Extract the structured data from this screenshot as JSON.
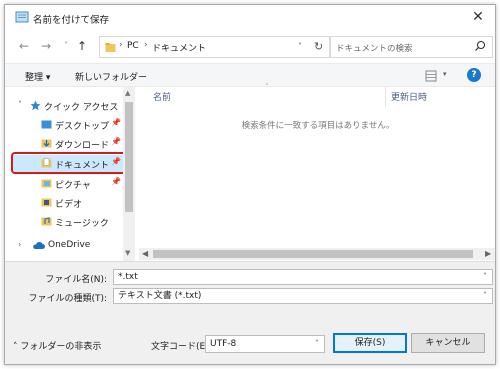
{
  "window": {
    "title": "名前を付けて保存"
  },
  "address_bar": {
    "path": [
      "PC",
      "ドキュメント"
    ],
    "search_placeholder": "ドキュメントの検索"
  },
  "toolbar": {
    "organize": "整理 ▾",
    "new_folder": "新しいフォルダー"
  },
  "nav": {
    "quick_access": "クイック アクセス",
    "items": [
      {
        "label": "デスクトップ"
      },
      {
        "label": "ダウンロード"
      },
      {
        "label": "ドキュメント"
      },
      {
        "label": "ピクチャ"
      },
      {
        "label": "ビデオ"
      },
      {
        "label": "ミュージック"
      }
    ],
    "onedrive": "OneDrive"
  },
  "content": {
    "col_name": "名前",
    "col_updated": "更新日時",
    "empty_message": "検索条件に一致する項目はありません。"
  },
  "form": {
    "filename_label": "ファイル名(N):",
    "filename_value": "*.txt",
    "filetype_label": "ファイルの種類(T):",
    "filetype_value": "テキスト文書 (*.txt)",
    "hide_folders": "フォルダーの非表示",
    "encoding_label": "文字コード(E):",
    "encoding_value": "UTF-8",
    "save": "保存(S)",
    "cancel": "キャンセル"
  },
  "colors": {
    "highlight_border": "#d21b1b",
    "help_icon": "#1979ca",
    "selected_bg": "#cce8ff"
  }
}
